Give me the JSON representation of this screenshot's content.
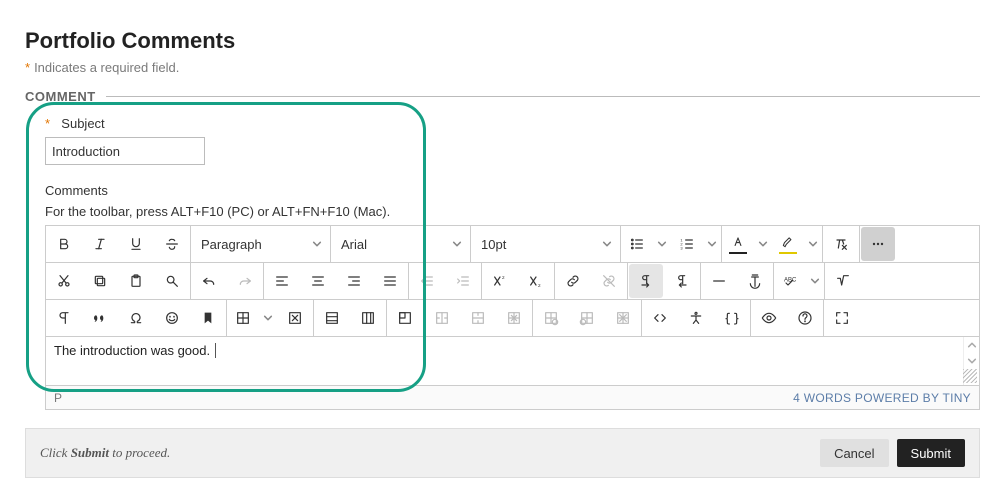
{
  "page_title": "Portfolio Comments",
  "required_note": "Indicates a required field.",
  "section_label": "COMMENT",
  "subject": {
    "label": "Subject",
    "value": "Introduction"
  },
  "comments_label": "Comments",
  "toolbar_help": "For the toolbar, press ALT+F10 (PC) or ALT+FN+F10 (Mac).",
  "block_format": "Paragraph",
  "font_family": "Arial",
  "font_size": "10pt",
  "editor_text": "The introduction was good.",
  "status_path": "P",
  "status_right": "4 WORDS  POWERED BY TINY",
  "footer_hint_pre": "Click ",
  "footer_hint_bold": "Submit",
  "footer_hint_post": " to proceed.",
  "buttons": {
    "cancel": "Cancel",
    "submit": "Submit"
  },
  "icons": {
    "bold": "bold",
    "italic": "italic",
    "underline": "underline",
    "strike": "strikethrough",
    "bullets": "bullet-list",
    "numbers": "number-list",
    "textcolor": "text-color",
    "highlight": "highlight",
    "clear": "clear-format",
    "more": "more",
    "cut": "cut",
    "copy": "copy",
    "paste": "paste",
    "find": "find",
    "undo": "undo",
    "redo": "redo",
    "al": "align-left",
    "ac": "align-center",
    "ar": "align-right",
    "aj": "align-justify",
    "indent": "indent",
    "outdent": "outdent",
    "sup": "superscript",
    "sub": "subscript",
    "link": "link",
    "unlink": "unlink",
    "ltr": "ltr",
    "rtl": "rtl",
    "hr": "hr",
    "anchor": "anchor",
    "spell": "spellcheck",
    "math": "math",
    "para": "paragraph",
    "quote": "quote",
    "omega": "special-char",
    "emoji": "emoji",
    "bookmark": "bookmark",
    "table": "table",
    "tdel": "table-delete",
    "trow": "table-row",
    "tcol": "table-col",
    "tcell": "table-cell",
    "tm1": "table-split",
    "tm2": "table-merge",
    "tm3": "table-props",
    "ts1": "table-insert-row",
    "ts2": "table-insert-col",
    "ts3": "table-clear",
    "code": "code",
    "a11y": "accessibility",
    "embed": "embed",
    "preview": "preview",
    "help": "help",
    "fullscreen": "fullscreen"
  }
}
